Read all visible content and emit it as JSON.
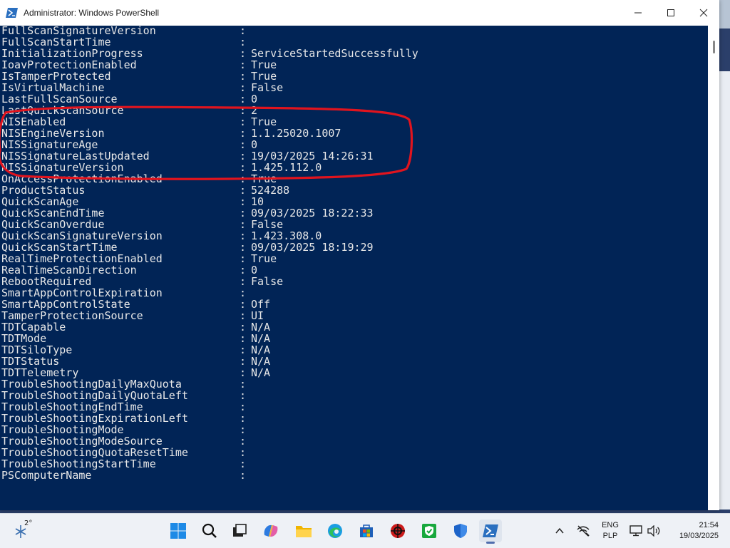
{
  "window": {
    "title": "Administrator: Windows PowerShell"
  },
  "console": {
    "lines": [
      {
        "key": "FullScanSignatureVersion",
        "value": ""
      },
      {
        "key": "FullScanStartTime",
        "value": ""
      },
      {
        "key": "InitializationProgress",
        "value": "ServiceStartedSuccessfully"
      },
      {
        "key": "IoavProtectionEnabled",
        "value": "True"
      },
      {
        "key": "IsTamperProtected",
        "value": "True"
      },
      {
        "key": "IsVirtualMachine",
        "value": "False"
      },
      {
        "key": "LastFullScanSource",
        "value": "0"
      },
      {
        "key": "LastQuickScanSource",
        "value": "2"
      },
      {
        "key": "NISEnabled",
        "value": "True"
      },
      {
        "key": "NISEngineVersion",
        "value": "1.1.25020.1007"
      },
      {
        "key": "NISSignatureAge",
        "value": "0"
      },
      {
        "key": "NISSignatureLastUpdated",
        "value": "19/03/2025 14:26:31"
      },
      {
        "key": "NISSignatureVersion",
        "value": "1.425.112.0"
      },
      {
        "key": "OnAccessProtectionEnabled",
        "value": "True"
      },
      {
        "key": "ProductStatus",
        "value": "524288"
      },
      {
        "key": "QuickScanAge",
        "value": "10"
      },
      {
        "key": "QuickScanEndTime",
        "value": "09/03/2025 18:22:33"
      },
      {
        "key": "QuickScanOverdue",
        "value": "False"
      },
      {
        "key": "QuickScanSignatureVersion",
        "value": "1.423.308.0"
      },
      {
        "key": "QuickScanStartTime",
        "value": "09/03/2025 18:19:29"
      },
      {
        "key": "RealTimeProtectionEnabled",
        "value": "True"
      },
      {
        "key": "RealTimeScanDirection",
        "value": "0"
      },
      {
        "key": "RebootRequired",
        "value": "False"
      },
      {
        "key": "SmartAppControlExpiration",
        "value": ""
      },
      {
        "key": "SmartAppControlState",
        "value": "Off"
      },
      {
        "key": "TamperProtectionSource",
        "value": "UI"
      },
      {
        "key": "TDTCapable",
        "value": "N/A"
      },
      {
        "key": "TDTMode",
        "value": "N/A"
      },
      {
        "key": "TDTSiloType",
        "value": "N/A"
      },
      {
        "key": "TDTStatus",
        "value": "N/A"
      },
      {
        "key": "TDTTelemetry",
        "value": "N/A"
      },
      {
        "key": "TroubleShootingDailyMaxQuota",
        "value": ""
      },
      {
        "key": "TroubleShootingDailyQuotaLeft",
        "value": ""
      },
      {
        "key": "TroubleShootingEndTime",
        "value": ""
      },
      {
        "key": "TroubleShootingExpirationLeft",
        "value": ""
      },
      {
        "key": "TroubleShootingMode",
        "value": ""
      },
      {
        "key": "TroubleShootingModeSource",
        "value": ""
      },
      {
        "key": "TroubleShootingQuotaResetTime",
        "value": ""
      },
      {
        "key": "TroubleShootingStartTime",
        "value": ""
      },
      {
        "key": "PSComputerName",
        "value": ""
      }
    ],
    "separator": ":",
    "background_color": "#012456",
    "text_color": "#e8e8e8"
  },
  "annotation": {
    "shape": "red-ellipse",
    "color": "#e0141e",
    "highlighted_keys": [
      "NISEnabled",
      "NISEngineVersion",
      "NISSignatureAge",
      "NISSignatureLastUpdated",
      "NISSignatureVersion"
    ]
  },
  "taskbar": {
    "weather_temp": "2°",
    "apps": [
      {
        "icon": "start-icon"
      },
      {
        "icon": "search-icon"
      },
      {
        "icon": "task-view-icon"
      },
      {
        "icon": "copilot-icon"
      },
      {
        "icon": "file-explorer-icon"
      },
      {
        "icon": "edge-icon"
      },
      {
        "icon": "microsoft-store-icon"
      },
      {
        "icon": "red-app-icon"
      },
      {
        "icon": "green-shield-app-icon"
      },
      {
        "icon": "defender-shield-icon"
      },
      {
        "icon": "powershell-icon",
        "active": true
      }
    ],
    "tray": {
      "language": "ENG",
      "layout": "PLP",
      "time": "21:54",
      "date": "19/03/2025"
    }
  }
}
